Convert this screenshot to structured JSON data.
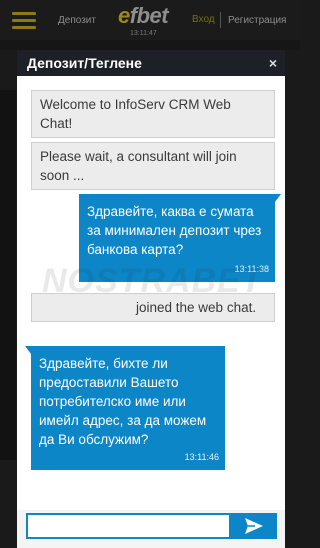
{
  "app_header": {
    "deposit_label": "Депозит",
    "logo": "efbet",
    "time": "13:11:47",
    "login_label": "Вход",
    "register_label": "Регистрация"
  },
  "dialog": {
    "title": "Депозит/Теглене",
    "close_symbol": "×"
  },
  "messages": [
    {
      "type": "system",
      "text": "Welcome to InfoServ CRM Web Chat!"
    },
    {
      "type": "system",
      "text": "Please wait, a consultant will join soon ..."
    },
    {
      "type": "outgoing",
      "text": "Здравейте, каква е сумата за минимален депозит чрез банкова карта?",
      "time": "13:11:38"
    },
    {
      "type": "system",
      "text": "joined the web chat."
    },
    {
      "type": "incoming",
      "text": "Здравейте, бихте ли предоставили Вашето потребителско име или имейл адрес, за да можем да Ви обслужим?",
      "time": "13:11:46"
    }
  ],
  "watermark": "NOSTRABET",
  "composer": {
    "input_value": "",
    "send_icon": "paper-plane-icon"
  },
  "colors": {
    "accent": "#0c86c7",
    "header_bg": "#1d2026",
    "system_bubble": "#ececec"
  }
}
